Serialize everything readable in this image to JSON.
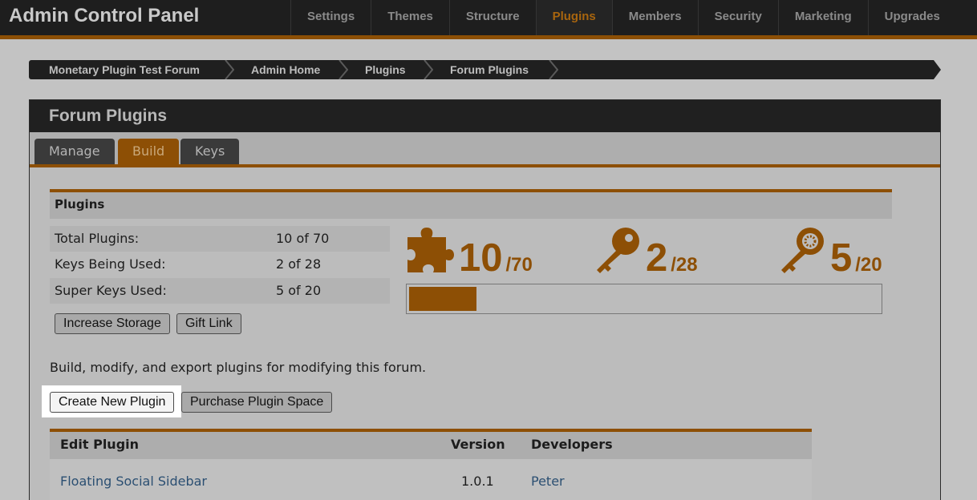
{
  "app_title": "Admin Control Panel",
  "nav": [
    "Settings",
    "Themes",
    "Structure",
    "Plugins",
    "Members",
    "Security",
    "Marketing",
    "Upgrades"
  ],
  "nav_active": "Plugins",
  "breadcrumb": [
    "Monetary Plugin Test Forum",
    "Admin Home",
    "Plugins",
    "Forum Plugins"
  ],
  "panel": {
    "title": "Forum Plugins",
    "tabs": [
      "Manage",
      "Build",
      "Keys"
    ],
    "active_tab": "Build"
  },
  "plugins_section": {
    "title": "Plugins",
    "stats": [
      {
        "label": "Total Plugins:",
        "value": "10 of 70"
      },
      {
        "label": "Keys Being Used:",
        "value": "2 of 28"
      },
      {
        "label": "Super Keys Used:",
        "value": "5 of 20"
      }
    ],
    "buttons": {
      "increase_storage": "Increase Storage",
      "gift_link": "Gift Link"
    },
    "counters": [
      {
        "icon": "puzzle-piece-icon",
        "value": "10",
        "total": "/70"
      },
      {
        "icon": "key-icon",
        "value": "2",
        "total": "/28"
      },
      {
        "icon": "super-key-icon",
        "value": "5",
        "total": "/20"
      }
    ],
    "storage_used_fraction": 0.143
  },
  "description": "Build, modify, and export plugins for modifying this forum.",
  "actions": {
    "create": "Create New Plugin",
    "purchase": "Purchase Plugin Space"
  },
  "table": {
    "headers": {
      "name": "Edit Plugin",
      "version": "Version",
      "developers": "Developers"
    },
    "rows": [
      {
        "name": "Floating Social Sidebar",
        "version": "1.0.1",
        "developers": "Peter"
      }
    ]
  },
  "colors": {
    "accent": "#8d4f05",
    "link": "#2b4f72",
    "topbar": "#1e1e1e"
  }
}
